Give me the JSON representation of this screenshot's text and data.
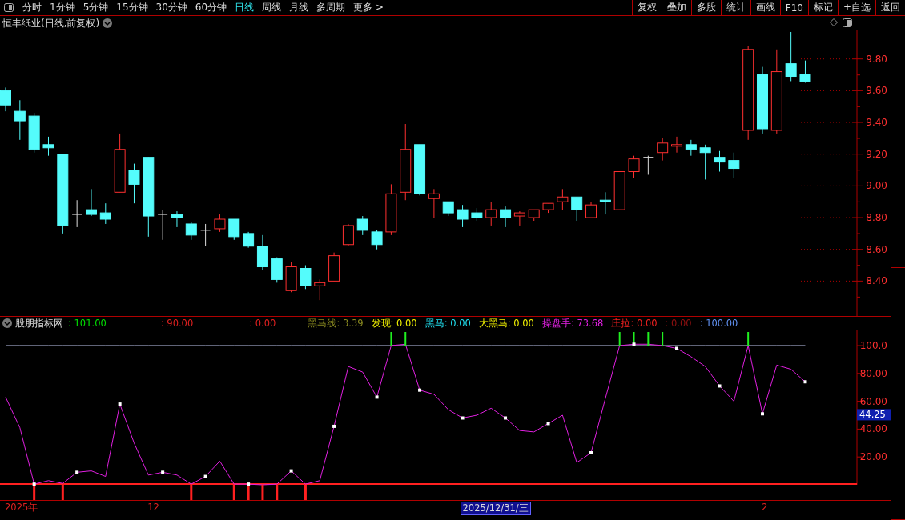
{
  "toolbar": {
    "periods": [
      {
        "label": "分时",
        "selected": false
      },
      {
        "label": "1分钟",
        "selected": false
      },
      {
        "label": "5分钟",
        "selected": false
      },
      {
        "label": "15分钟",
        "selected": false
      },
      {
        "label": "30分钟",
        "selected": false
      },
      {
        "label": "60分钟",
        "selected": false
      },
      {
        "label": "日线",
        "selected": true
      },
      {
        "label": "周线",
        "selected": false
      },
      {
        "label": "月线",
        "selected": false
      },
      {
        "label": "多周期",
        "selected": false
      },
      {
        "label": "更多 >",
        "selected": false
      }
    ],
    "buttons": [
      "复权",
      "叠加",
      "多股",
      "统计",
      "画线",
      "F10",
      "标记",
      "+自选",
      "返回"
    ]
  },
  "price_chart": {
    "title": "恒丰纸业(日线,前复权)",
    "chart_data": {
      "type": "candlestick",
      "ylim": [
        8.18,
        9.98
      ],
      "yticks": [
        {
          "value": 9.8,
          "label": "9.80"
        },
        {
          "value": 9.6,
          "label": "9.60"
        },
        {
          "value": 9.4,
          "label": "9.40"
        },
        {
          "value": 9.2,
          "label": "9.20"
        },
        {
          "value": 9.0,
          "label": "9.00"
        },
        {
          "value": 8.8,
          "label": "8.80"
        },
        {
          "value": 8.6,
          "label": "8.60"
        },
        {
          "value": 8.4,
          "label": "8.40"
        }
      ],
      "ohlc": [
        [
          9.6,
          9.62,
          9.47,
          9.51
        ],
        [
          9.47,
          9.54,
          9.29,
          9.41
        ],
        [
          9.44,
          9.46,
          9.21,
          9.23
        ],
        [
          9.26,
          9.31,
          9.19,
          9.24
        ],
        [
          9.2,
          9.2,
          8.7,
          8.75
        ],
        [
          8.82,
          8.91,
          8.74,
          8.82
        ],
        [
          8.85,
          8.98,
          8.81,
          8.82
        ],
        [
          8.83,
          8.89,
          8.76,
          8.79
        ],
        [
          8.96,
          9.33,
          8.96,
          9.23
        ],
        [
          9.1,
          9.14,
          8.89,
          9.01
        ],
        [
          9.18,
          9.18,
          8.68,
          8.81
        ],
        [
          8.82,
          8.85,
          8.66,
          8.82
        ],
        [
          8.82,
          8.84,
          8.74,
          8.8
        ],
        [
          8.76,
          8.77,
          8.66,
          8.69
        ],
        [
          8.72,
          8.76,
          8.62,
          8.72
        ],
        [
          8.73,
          8.82,
          8.71,
          8.79
        ],
        [
          8.79,
          8.79,
          8.66,
          8.68
        ],
        [
          8.7,
          8.71,
          8.61,
          8.62
        ],
        [
          8.62,
          8.69,
          8.47,
          8.49
        ],
        [
          8.54,
          8.55,
          8.39,
          8.41
        ],
        [
          8.34,
          8.52,
          8.33,
          8.49
        ],
        [
          8.48,
          8.5,
          8.35,
          8.37
        ],
        [
          8.37,
          8.41,
          8.28,
          8.39
        ],
        [
          8.4,
          8.58,
          8.4,
          8.56
        ],
        [
          8.63,
          8.76,
          8.62,
          8.75
        ],
        [
          8.79,
          8.81,
          8.69,
          8.72
        ],
        [
          8.71,
          8.72,
          8.6,
          8.63
        ],
        [
          8.71,
          9.01,
          8.69,
          8.95
        ],
        [
          8.96,
          9.39,
          8.91,
          9.23
        ],
        [
          9.26,
          9.26,
          8.94,
          8.95
        ],
        [
          8.92,
          8.98,
          8.8,
          8.95
        ],
        [
          8.9,
          8.9,
          8.81,
          8.83
        ],
        [
          8.85,
          8.88,
          8.74,
          8.79
        ],
        [
          8.83,
          8.86,
          8.78,
          8.8
        ],
        [
          8.8,
          8.9,
          8.75,
          8.85
        ],
        [
          8.85,
          8.87,
          8.74,
          8.8
        ],
        [
          8.81,
          8.84,
          8.75,
          8.83
        ],
        [
          8.8,
          8.85,
          8.78,
          8.85
        ],
        [
          8.85,
          8.89,
          8.83,
          8.89
        ],
        [
          8.9,
          8.98,
          8.85,
          8.93
        ],
        [
          8.93,
          8.93,
          8.78,
          8.85
        ],
        [
          8.8,
          8.9,
          8.8,
          8.88
        ],
        [
          8.91,
          8.96,
          8.82,
          8.9
        ],
        [
          8.85,
          9.09,
          8.85,
          9.09
        ],
        [
          9.09,
          9.19,
          9.05,
          9.17
        ],
        [
          9.18,
          9.19,
          9.07,
          9.18
        ],
        [
          9.21,
          9.3,
          9.16,
          9.27
        ],
        [
          9.25,
          9.31,
          9.21,
          9.26
        ],
        [
          9.26,
          9.29,
          9.19,
          9.23
        ],
        [
          9.24,
          9.26,
          9.04,
          9.21
        ],
        [
          9.18,
          9.22,
          9.09,
          9.15
        ],
        [
          9.16,
          9.21,
          9.05,
          9.11
        ],
        [
          9.35,
          9.88,
          9.29,
          9.86
        ],
        [
          9.7,
          9.75,
          9.33,
          9.36
        ],
        [
          9.35,
          9.86,
          9.33,
          9.72
        ],
        [
          9.77,
          9.97,
          9.66,
          9.69
        ],
        [
          9.7,
          9.79,
          9.65,
          9.66
        ]
      ]
    }
  },
  "indicator": {
    "name": "股朋指标网",
    "legend": [
      {
        "text": ": 101.00",
        "color": "#00e000"
      },
      {
        "text": ": 90.00",
        "color": "#e02020"
      },
      {
        "text": ": 0.00",
        "color": "#e02020"
      },
      {
        "text": "黑马线: 3.39",
        "color": "#8a8a20"
      },
      {
        "text": "发现: 0.00",
        "color": "#f0f000"
      },
      {
        "text": "黑马: 0.00",
        "color": "#20e0f0"
      },
      {
        "text": "大黑马: 0.00",
        "color": "#f0f000"
      },
      {
        "text": "操盘手: 73.68",
        "color": "#e020e0"
      },
      {
        "text": "庄拉: 0.00",
        "color": "#f02020"
      },
      {
        "text": ": 0.00",
        "color": "#901010"
      },
      {
        "text": ": 100.00",
        "color": "#6090f0"
      }
    ],
    "current_value": "44.25",
    "chart_data": {
      "type": "line",
      "ylim": [
        0,
        111.5
      ],
      "yticks": [
        {
          "value": 100,
          "label": "100.0"
        },
        {
          "value": 80,
          "label": "80.00"
        },
        {
          "value": 60,
          "label": "60.00"
        },
        {
          "value": 40,
          "label": "40.00"
        },
        {
          "value": 20,
          "label": "20.00"
        }
      ],
      "series": [
        {
          "color": "#c0c8f0",
          "values": [
            100,
            100,
            100,
            100,
            100,
            100,
            100,
            100,
            100,
            100,
            100,
            100,
            100,
            100,
            100,
            100,
            100,
            100,
            100,
            100,
            100,
            100,
            100,
            100,
            100,
            100,
            100,
            100,
            100,
            100,
            100,
            100,
            100,
            100,
            100,
            100,
            100,
            100,
            100,
            100,
            100,
            100,
            100,
            100,
            100,
            100,
            100,
            100,
            100,
            100,
            100,
            100,
            100,
            100,
            100,
            100,
            100
          ]
        },
        {
          "color": "#e020e0",
          "values": [
            63,
            41,
            0.5,
            3,
            1,
            9,
            10,
            6,
            58,
            30,
            7,
            9,
            7,
            0.5,
            6,
            17,
            0.5,
            0.5,
            0,
            0.5,
            10,
            0.5,
            3,
            42,
            85,
            81,
            63,
            100,
            101,
            68,
            65,
            54,
            48,
            50,
            55,
            48,
            39,
            38,
            44,
            50,
            16,
            23,
            62,
            100,
            101,
            101,
            100,
            98,
            92,
            85,
            71,
            60,
            100,
            51,
            86,
            83,
            74
          ]
        }
      ]
    }
  },
  "date_axis": {
    "labels": [
      {
        "text": "2025年",
        "selected": false
      },
      {
        "text": "12",
        "selected": false
      },
      {
        "text": "2025/12/31/三",
        "selected": true
      },
      {
        "text": "2",
        "selected": false
      }
    ]
  }
}
